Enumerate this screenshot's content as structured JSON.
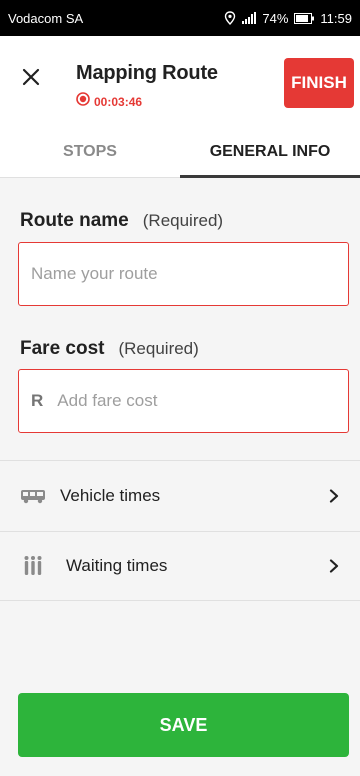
{
  "status_bar": {
    "carrier": "Vodacom SA",
    "battery": "74%",
    "time": "11:59"
  },
  "header": {
    "title": "Mapping Route",
    "timer": "00:03:46",
    "finish_label": "FINISH"
  },
  "tabs": [
    {
      "label": "STOPS",
      "active": false
    },
    {
      "label": "GENERAL INFO",
      "active": true
    }
  ],
  "form": {
    "route_name": {
      "label": "Route name",
      "required": "(Required)",
      "placeholder": "Name your route",
      "value": ""
    },
    "fare_cost": {
      "label": "Fare cost",
      "required": "(Required)",
      "prefix": "R",
      "placeholder": "Add fare cost",
      "value": ""
    }
  },
  "list": [
    {
      "label": "Vehicle times",
      "icon": "bus-icon"
    },
    {
      "label": "Waiting times",
      "icon": "people-queue-icon"
    }
  ],
  "save_label": "SAVE",
  "colors": {
    "accent_red": "#e53935",
    "save_green": "#2db43b"
  }
}
